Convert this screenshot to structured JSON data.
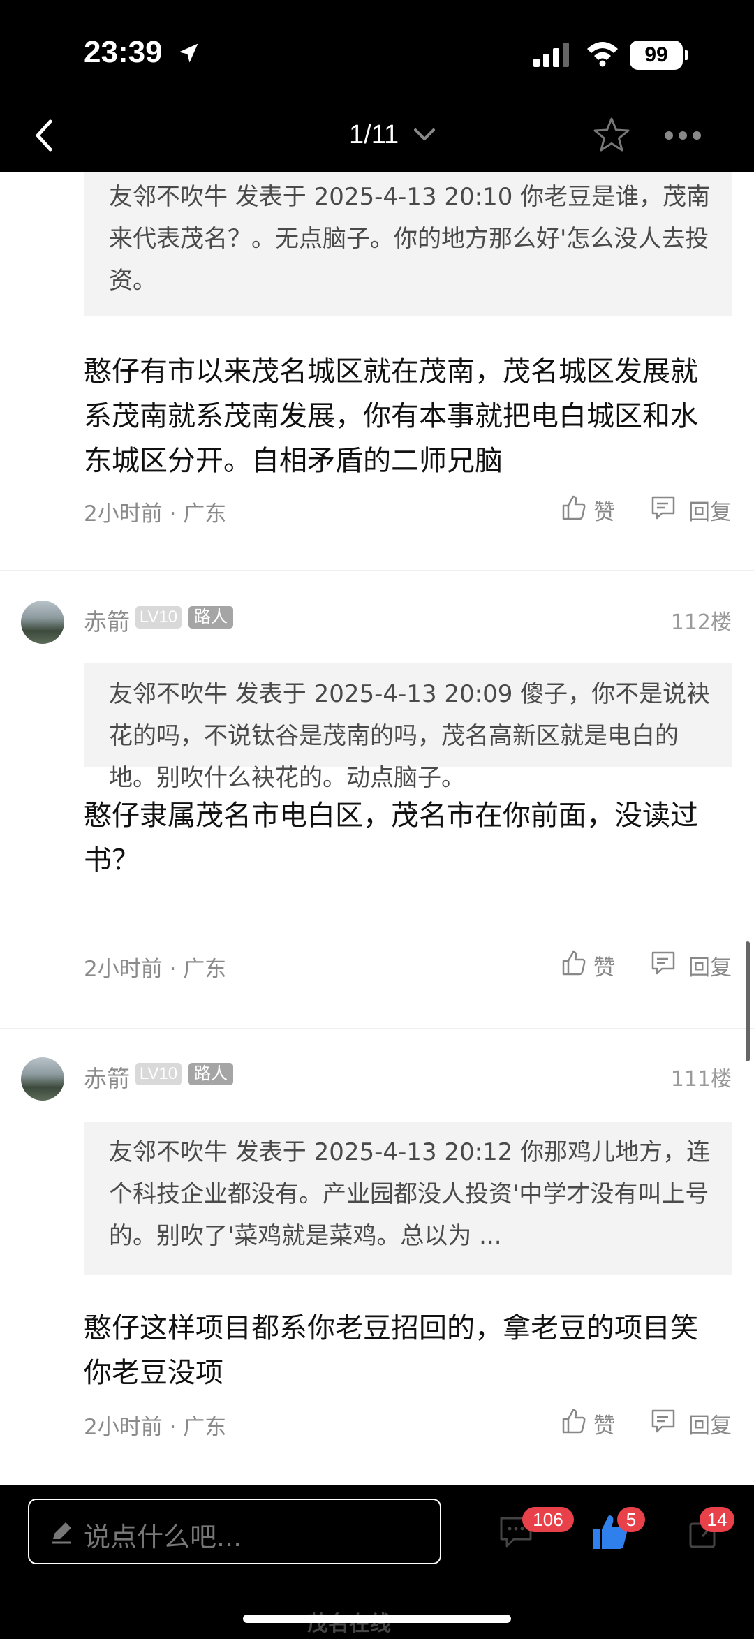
{
  "status_bar": {
    "time": "23:39",
    "battery": "99"
  },
  "navbar": {
    "page_indicator": "1/11"
  },
  "comments": [
    {
      "quote": "友邻不吹牛 发表于 2025-4-13 20:10 你老豆是谁，茂南来代表茂名？。无点脑子。你的地方那么好'怎么没人去投资。",
      "text": "憨仔有市以来茂名城区就在茂南，茂名城区发展就系茂南就系茂南发展，你有本事就把电白城区和水东城区分开。自相矛盾的二师兄脑",
      "meta": "2小时前 · 广东",
      "like": "赞",
      "reply": "回复"
    },
    {
      "user": "赤箭",
      "level": "LV10",
      "role": "路人",
      "floor": "112楼",
      "quote": "友邻不吹牛 发表于 2025-4-13 20:09 傻子，你不是说袂花的吗，不说钛谷是茂南的吗，茂名高新区就是电白的地。别吹什么袂花的。动点脑子。",
      "text": "憨仔隶属茂名市电白区，茂名市在你前面，没读过书？",
      "meta": "2小时前 · 广东",
      "like": "赞",
      "reply": "回复"
    },
    {
      "user": "赤箭",
      "level": "LV10",
      "role": "路人",
      "floor": "111楼",
      "quote": "友邻不吹牛 发表于 2025-4-13 20:12 你那鸡儿地方，连个科技企业都没有。产业园都没人投资'中学才没有叫上号的。别吹了'菜鸡就是菜鸡。总以为 ...",
      "text": "憨仔这样项目都系你老豆招回的，拿老豆的项目笑你老豆没项",
      "meta": "2小时前 · 广东",
      "like": "赞",
      "reply": "回复"
    }
  ],
  "bottom_bar": {
    "input_placeholder": "说点什么吧...",
    "comment_count": "106",
    "like_count": "5",
    "share_count": "14"
  },
  "watermark": "茂名在线"
}
